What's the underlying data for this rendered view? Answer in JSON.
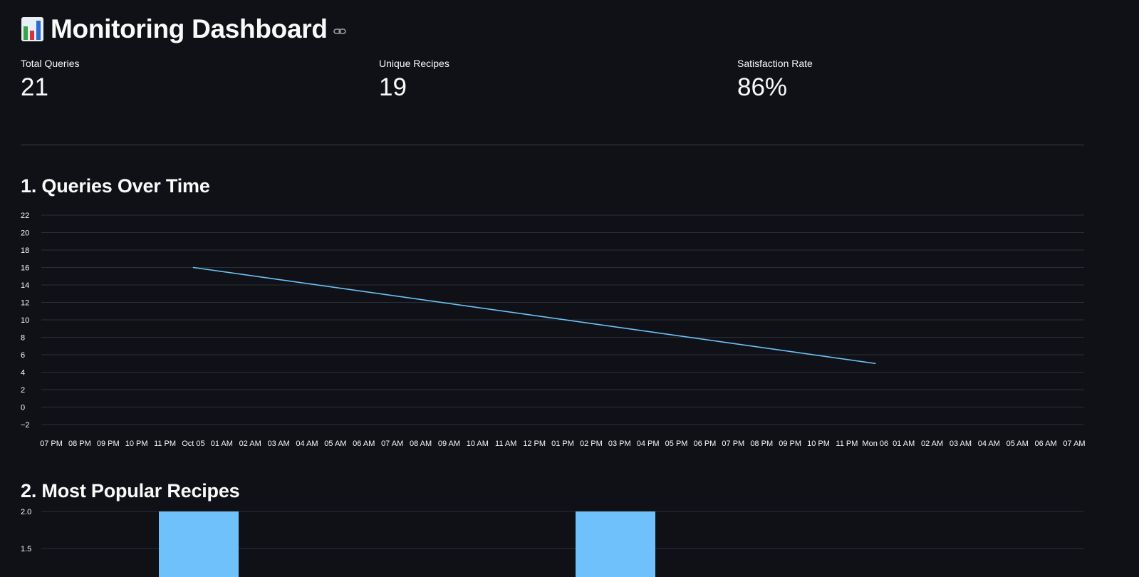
{
  "header": {
    "title": "Monitoring Dashboard",
    "emoji_icon": "bar-chart-emoji-icon",
    "link_icon": "link-icon"
  },
  "metrics": [
    {
      "label": "Total Queries",
      "value": "21"
    },
    {
      "label": "Unique Recipes",
      "value": "19"
    },
    {
      "label": "Satisfaction Rate",
      "value": "86%"
    }
  ],
  "sections": {
    "queries_over_time": "1. Queries Over Time",
    "popular_recipes": "2. Most Popular Recipes"
  },
  "colors": {
    "background": "#0f1116",
    "line": "#6ec1fa",
    "bar": "#6ec1fa",
    "grid": "#2b2e36"
  },
  "chart_data": [
    {
      "type": "line",
      "title": "1. Queries Over Time",
      "xlabel": "",
      "ylabel": "",
      "ylim": [
        -2,
        22
      ],
      "yticks": [
        -2,
        0,
        2,
        4,
        6,
        8,
        10,
        12,
        14,
        16,
        18,
        20,
        22
      ],
      "xtick_labels": [
        "07 PM",
        "08 PM",
        "09 PM",
        "10 PM",
        "11 PM",
        "Oct 05",
        "01 AM",
        "02 AM",
        "03 AM",
        "04 AM",
        "05 AM",
        "06 AM",
        "07 AM",
        "08 AM",
        "09 AM",
        "10 AM",
        "11 AM",
        "12 PM",
        "01 PM",
        "02 PM",
        "03 PM",
        "04 PM",
        "05 PM",
        "06 PM",
        "07 PM",
        "08 PM",
        "09 PM",
        "10 PM",
        "11 PM",
        "Mon 06",
        "01 AM",
        "02 AM",
        "03 AM",
        "04 AM",
        "05 AM",
        "06 AM",
        "07 AM"
      ],
      "series": [
        {
          "points": [
            {
              "x": "Oct 05 12:00 AM",
              "y": 16
            },
            {
              "x": "Mon 06 12:00 AM",
              "y": 5
            }
          ]
        }
      ],
      "grid": true
    },
    {
      "type": "bar",
      "title": "2. Most Popular Recipes",
      "ylabel": "",
      "ylim": [
        0,
        2.0
      ],
      "yticks": [
        1.5,
        2.0
      ],
      "bars_visible": [
        {
          "value": 2
        },
        {
          "value": 2
        }
      ],
      "grid": true
    }
  ]
}
